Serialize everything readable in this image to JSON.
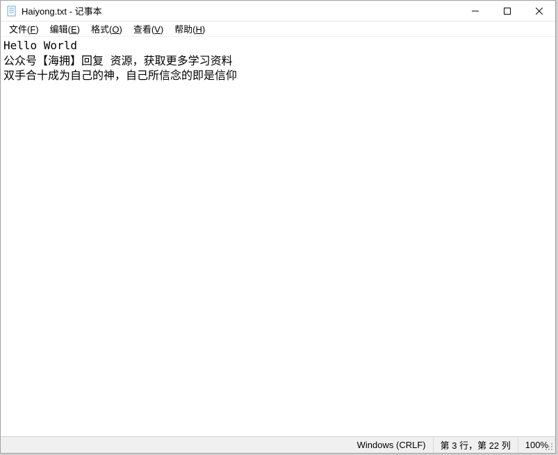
{
  "title": "Haiyong.txt - 记事本",
  "menu": {
    "file": {
      "label": "文件(",
      "key": "F",
      "suffix": ")"
    },
    "edit": {
      "label": "编辑(",
      "key": "E",
      "suffix": ")"
    },
    "format": {
      "label": "格式(",
      "key": "O",
      "suffix": ")"
    },
    "view": {
      "label": "查看(",
      "key": "V",
      "suffix": ")"
    },
    "help": {
      "label": "帮助(",
      "key": "H",
      "suffix": ")"
    }
  },
  "content": "Hello World\n公众号【海拥】回复 资源，获取更多学习资料\n双手合十成为自己的神，自己所信念的即是信仰",
  "status": {
    "encoding": "Windows (CRLF)",
    "position": "第 3 行，第 22 列",
    "zoom": "100%"
  }
}
